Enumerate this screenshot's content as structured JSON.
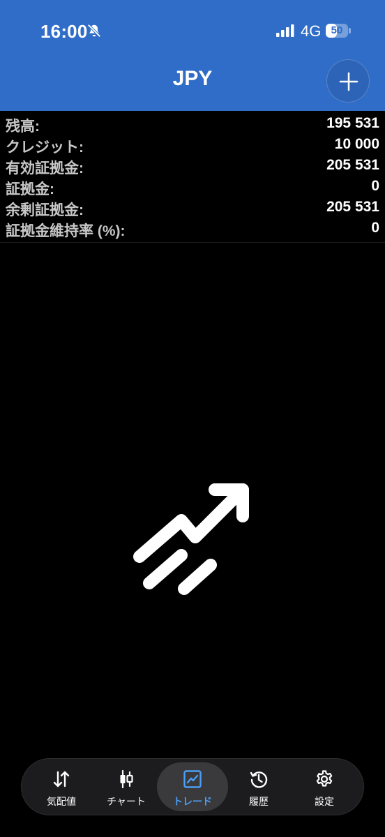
{
  "status_bar": {
    "time": "16:00",
    "network": "4G",
    "battery": "50",
    "battery_fraction": 0.5
  },
  "header": {
    "title": "JPY",
    "add_icon": "plus-icon"
  },
  "summary": {
    "rows": [
      {
        "label": "残高:",
        "value": "195 531"
      },
      {
        "label": "クレジット:",
        "value": "10 000"
      },
      {
        "label": "有効証拠金:",
        "value": "205 531"
      },
      {
        "label": "証拠金:",
        "value": "0"
      },
      {
        "label": "余剰証拠金:",
        "value": "205 531"
      },
      {
        "label": "証拠金維持率 (%):",
        "value": "0"
      }
    ]
  },
  "empty_state": {
    "icon": "trending-up-icon"
  },
  "nav": {
    "active": "trade",
    "items": [
      {
        "id": "quotes",
        "label": "気配値",
        "icon": "quotes-arrows-icon"
      },
      {
        "id": "chart",
        "label": "チャート",
        "icon": "candlestick-icon"
      },
      {
        "id": "trade",
        "label": "トレード",
        "icon": "trade-chart-icon"
      },
      {
        "id": "history",
        "label": "履歴",
        "icon": "history-icon"
      },
      {
        "id": "settings",
        "label": "設定",
        "icon": "gear-icon"
      }
    ]
  },
  "colors": {
    "header_bg": "#2f6dc8",
    "background": "#000000",
    "active_accent": "#4a9ff5",
    "label_gray": "#c7c7c7"
  }
}
